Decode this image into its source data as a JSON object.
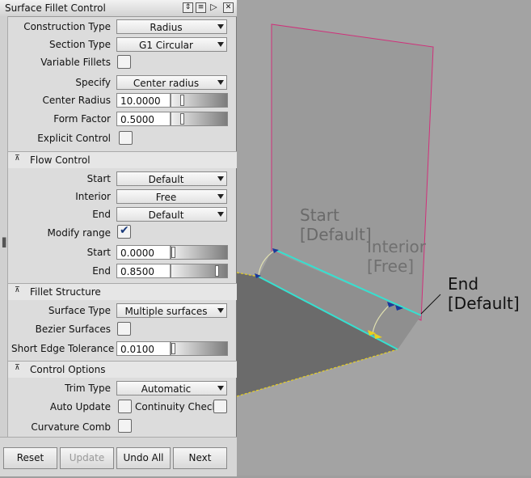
{
  "window": {
    "title": "Surface Fillet Control"
  },
  "construction_type": {
    "label": "Construction Type",
    "value": "Radius"
  },
  "section_type": {
    "label": "Section Type",
    "value": "G1 Circular"
  },
  "variable_fillets": {
    "label": "Variable Fillets",
    "checked": false
  },
  "specify": {
    "label": "Specify",
    "value": "Center radius"
  },
  "center_radius": {
    "label": "Center Radius",
    "value": "10.0000"
  },
  "form_factor": {
    "label": "Form Factor",
    "value": "0.5000"
  },
  "explicit_control": {
    "label": "Explicit Control",
    "checked": false
  },
  "flow_control": {
    "title": "Flow Control",
    "start": {
      "label": "Start",
      "value": "Default"
    },
    "interior": {
      "label": "Interior",
      "value": "Free"
    },
    "end": {
      "label": "End",
      "value": "Default"
    },
    "modify_range": {
      "label": "Modify range",
      "checked": true
    },
    "range_start": {
      "label": "Start",
      "value": "0.0000",
      "level": 0.0
    },
    "range_end": {
      "label": "End",
      "value": "0.8500",
      "level": 0.85
    }
  },
  "fillet_structure": {
    "title": "Fillet Structure",
    "surface_type": {
      "label": "Surface Type",
      "value": "Multiple surfaces"
    },
    "bezier_surfaces": {
      "label": "Bezier Surfaces",
      "checked": false
    },
    "short_edge_tolerance": {
      "label": "Short Edge Tolerance",
      "value": "0.0100"
    }
  },
  "control_options": {
    "title": "Control Options",
    "trim_type": {
      "label": "Trim Type",
      "value": "Automatic"
    },
    "auto_update": {
      "label": "Auto Update",
      "checked": false
    },
    "continuity_check": {
      "label": "Continuity Check",
      "checked": false
    },
    "curvature_comb": {
      "label": "Curvature Comb",
      "checked": false
    }
  },
  "buttons": {
    "reset": "Reset",
    "update": "Update",
    "undo_all": "Undo All",
    "next": "Next"
  },
  "viewport": {
    "start_label": "Start\n[Default]",
    "interior_label": "Interior\n[Free]",
    "end_label": "End\n[Default]"
  },
  "colors": {
    "edge_magenta": "#d0307a",
    "edge_cyan": "#36e0d0",
    "edge_yellow": "#e8d020",
    "accent_blue": "#1a3a7a"
  }
}
